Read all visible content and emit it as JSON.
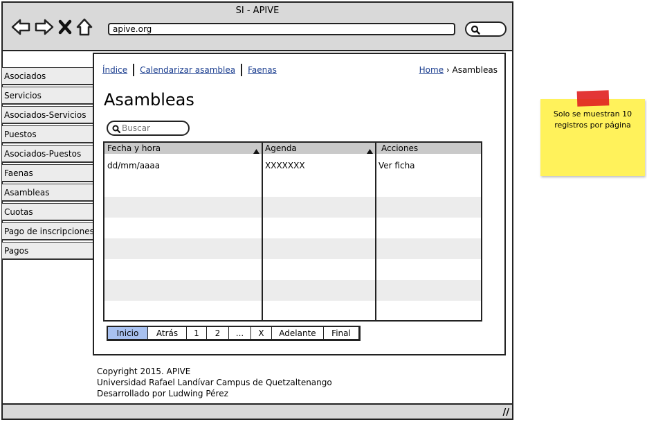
{
  "window": {
    "title": "SI - APIVE"
  },
  "browser": {
    "url": "apive.org"
  },
  "sidebar": {
    "items": [
      {
        "label": "Asociados"
      },
      {
        "label": "Servicios"
      },
      {
        "label": "Asociados-Servicios"
      },
      {
        "label": "Puestos"
      },
      {
        "label": "Asociados-Puestos"
      },
      {
        "label": "Faenas"
      },
      {
        "label": "Asambleas"
      },
      {
        "label": "Cuotas"
      },
      {
        "label": "Pago de inscripciones"
      },
      {
        "label": "Pagos"
      }
    ]
  },
  "tabs": [
    {
      "label": "Índice"
    },
    {
      "label": "Calendarizar asamblea"
    },
    {
      "label": "Faenas"
    }
  ],
  "breadcrumb": {
    "home": "Home",
    "separator": "›",
    "current": "Asambleas"
  },
  "page": {
    "title": "Asambleas"
  },
  "search": {
    "placeholder": "Buscar"
  },
  "table": {
    "columns": [
      "Fecha y hora",
      "Agenda",
      "Acciones"
    ],
    "rows": [
      [
        "dd/mm/aaaa",
        "XXXXXXX",
        "Ver ficha"
      ]
    ]
  },
  "pager": {
    "buttons": [
      "Inicio",
      "Atrás",
      "1",
      "2",
      "...",
      "X",
      "Adelante",
      "Final"
    ],
    "active": "Inicio"
  },
  "footer": {
    "line1": "Copyright 2015.  APIVE",
    "line2": "Universidad Rafael Landívar Campus de Quetzaltenango",
    "line3": "Desarrollado por Ludwing Pérez"
  },
  "note": {
    "text": "Solo se muestran 10 registros por página"
  },
  "colors": {
    "link": "#1a3d8f",
    "active_page": "#a8c1f0",
    "note": "#fff25b",
    "tape": "#e02020"
  }
}
